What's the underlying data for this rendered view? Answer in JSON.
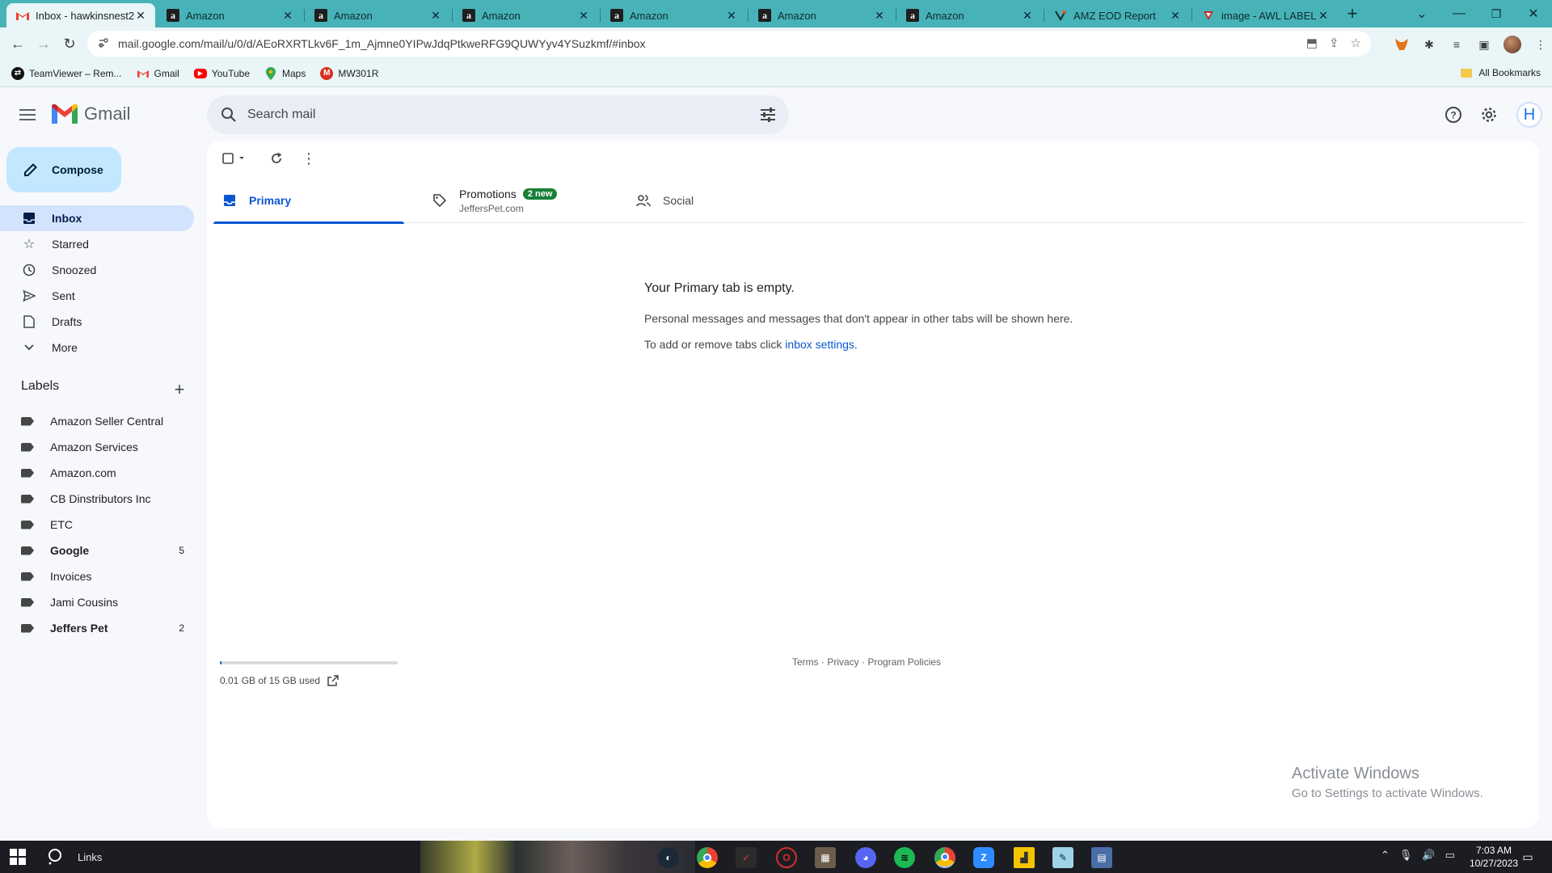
{
  "browser": {
    "tabs": [
      {
        "title": "Inbox - hawkinsnest2",
        "icon": "gmail-icon",
        "active": true
      },
      {
        "title": "Amazon",
        "icon": "amazon-icon"
      },
      {
        "title": "Amazon",
        "icon": "amazon-icon"
      },
      {
        "title": "Amazon",
        "icon": "amazon-icon"
      },
      {
        "title": "Amazon",
        "icon": "amazon-icon"
      },
      {
        "title": "Amazon",
        "icon": "amazon-icon"
      },
      {
        "title": "Amazon",
        "icon": "amazon-icon"
      },
      {
        "title": "AMZ EOD Report",
        "icon": "sheets-icon"
      },
      {
        "title": "image - AWL LABEL",
        "icon": "awl-icon"
      }
    ],
    "url": "mail.google.com/mail/u/0/d/AEoRXRTLkv6F_1m_Ajmne0YIPwJdqPtkweRFG9QUWYyv4YSuzkmf/#inbox",
    "bookmarks": [
      {
        "label": "TeamViewer – Rem...",
        "icon": "teamviewer-icon"
      },
      {
        "label": "Gmail",
        "icon": "gmail-icon"
      },
      {
        "label": "YouTube",
        "icon": "youtube-icon"
      },
      {
        "label": "Maps",
        "icon": "maps-icon"
      },
      {
        "label": "MW301R",
        "icon": "mw-icon"
      }
    ],
    "all_bookmarks": "All Bookmarks"
  },
  "gmail": {
    "app_name": "Gmail",
    "search_placeholder": "Search mail",
    "avatar_letter": "H",
    "compose_label": "Compose",
    "nav": [
      {
        "label": "Inbox",
        "icon": "inbox-icon",
        "active": true
      },
      {
        "label": "Starred",
        "icon": "star-icon"
      },
      {
        "label": "Snoozed",
        "icon": "clock-icon"
      },
      {
        "label": "Sent",
        "icon": "send-icon"
      },
      {
        "label": "Drafts",
        "icon": "draft-icon"
      },
      {
        "label": "More",
        "icon": "chevron-down-icon"
      }
    ],
    "labels_heading": "Labels",
    "labels": [
      {
        "name": "Amazon Seller Central",
        "count": "",
        "bold": false
      },
      {
        "name": "Amazon Services",
        "count": "",
        "bold": false
      },
      {
        "name": "Amazon.com",
        "count": "",
        "bold": false
      },
      {
        "name": "CB Dinstributors Inc",
        "count": "",
        "bold": false
      },
      {
        "name": "ETC",
        "count": "",
        "bold": false
      },
      {
        "name": "Google",
        "count": "5",
        "bold": true
      },
      {
        "name": "Invoices",
        "count": "",
        "bold": false
      },
      {
        "name": "Jami Cousins",
        "count": "",
        "bold": false
      },
      {
        "name": "Jeffers Pet",
        "count": "2",
        "bold": true
      }
    ],
    "inbox_tabs": {
      "primary": "Primary",
      "promotions": "Promotions",
      "promotions_badge": "2 new",
      "promotions_sender": "JeffersPet.com",
      "social": "Social"
    },
    "empty_state": {
      "title": "Your Primary tab is empty.",
      "line1": "Personal messages and messages that don't appear in other tabs will be shown here.",
      "line2_prefix": "To add or remove tabs click ",
      "line2_link": "inbox settings",
      "line2_suffix": "."
    },
    "storage": {
      "text": "0.01 GB of 15 GB used",
      "fraction": 0.001
    },
    "footer": {
      "terms": "Terms",
      "sep1": " · ",
      "privacy": "Privacy",
      "sep2": " · ",
      "policies": "Program Policies"
    },
    "colors": {
      "accent": "#0b57d0",
      "compose_bg": "#c2e7ff",
      "active_nav": "#d3e3fd",
      "badge_green": "#188038",
      "chrome_tabstrip": "#47b3b9"
    }
  },
  "windows": {
    "activate_title": "Activate Windows",
    "activate_sub": "Go to Settings to activate Windows.",
    "taskbar_search": "Links",
    "time": "7:03 AM",
    "date": "10/27/2023"
  }
}
